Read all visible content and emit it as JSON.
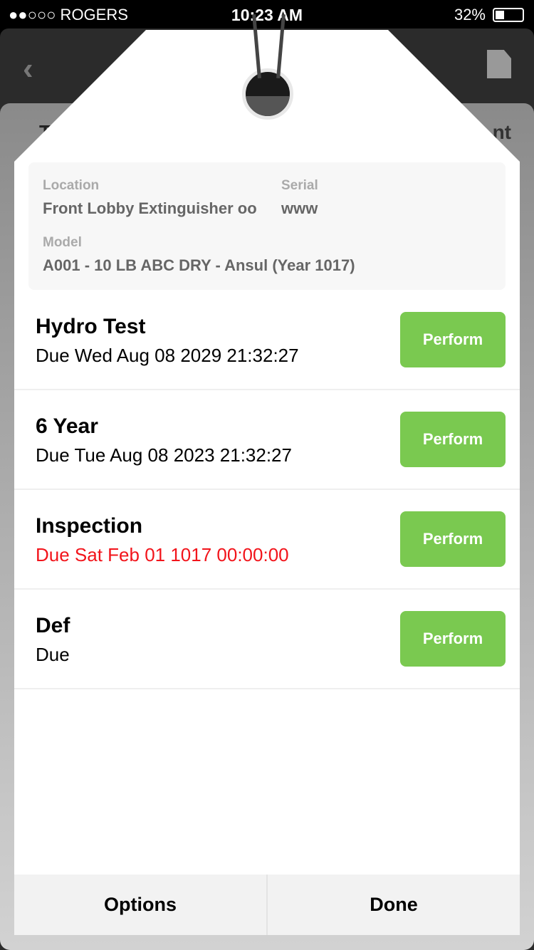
{
  "status_bar": {
    "carrier": "●●○○○ ROGERS",
    "time": "10:23 AM",
    "battery": "32%",
    "battery_level": 0.32
  },
  "background": {
    "title_fragment_left": "T",
    "title_fragment_right": "nt"
  },
  "info": {
    "location_label": "Location",
    "location": "Front Lobby Extinguisher oo",
    "serial_label": "Serial",
    "serial": "www",
    "model_label": "Model",
    "model": "A001 - 10 LB ABC DRY - Ansul (Year 1017)"
  },
  "tasks": [
    {
      "name": "Hydro Test",
      "due": "Due Wed Aug 08 2029 21:32:27",
      "overdue": false,
      "button": "Perform"
    },
    {
      "name": "6 Year",
      "due": "Due Tue Aug 08 2023 21:32:27",
      "overdue": false,
      "button": "Perform"
    },
    {
      "name": "Inspection",
      "due": "Due Sat Feb 01 1017 00:00:00",
      "overdue": true,
      "button": "Perform"
    },
    {
      "name": "Def",
      "due": "Due",
      "overdue": false,
      "button": "Perform"
    }
  ],
  "footer": {
    "options": "Options",
    "done": "Done"
  },
  "colors": {
    "perform": "#7ac950",
    "overdue": "#f2141b"
  }
}
